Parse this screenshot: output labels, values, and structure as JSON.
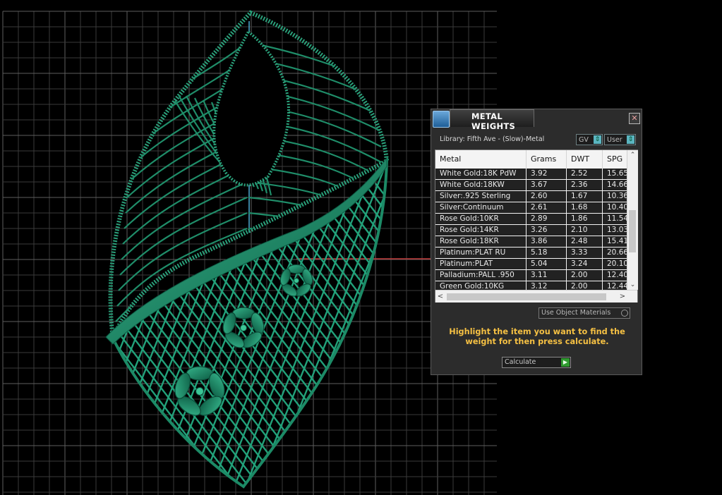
{
  "panel": {
    "title": "METAL WEIGHTS",
    "close_glyph": "✕",
    "library": "Library: Fifth Ave - (Slow)-Metal",
    "gv_label": "GV",
    "user_label": "User",
    "toggle_glyph": "⇕",
    "columns": [
      "Metal",
      "Grams",
      "DWT",
      "SPG"
    ],
    "rows": [
      [
        "White Gold:18K PdW",
        "3.92",
        "2.52",
        "15.65"
      ],
      [
        "White Gold:18KW",
        "3.67",
        "2.36",
        "14.66"
      ],
      [
        "Silver:.925 Sterling",
        "2.60",
        "1.67",
        "10.36"
      ],
      [
        "Silver:Continuum",
        "2.61",
        "1.68",
        "10.40"
      ],
      [
        "Rose Gold:10KR",
        "2.89",
        "1.86",
        "11.54"
      ],
      [
        "Rose Gold:14KR",
        "3.26",
        "2.10",
        "13.03"
      ],
      [
        "Rose Gold:18KR",
        "3.86",
        "2.48",
        "15.41"
      ],
      [
        "Platinum:PLAT RU",
        "5.18",
        "3.33",
        "20.66"
      ],
      [
        "Platinum:PLAT",
        "5.04",
        "3.24",
        "20.10"
      ],
      [
        "Palladium:PALL .950",
        "3.11",
        "2.00",
        "12.40"
      ],
      [
        "Green Gold:10KG",
        "3.12",
        "2.00",
        "12.44"
      ]
    ],
    "scroll_up": "⌃",
    "scroll_down": "⌄",
    "scroll_left": "<",
    "scroll_right": ">",
    "use_object_materials": "Use Object Materials",
    "hint": "Highlight the item you want to find the weight for then press calculate.",
    "calculate_label": "Calculate",
    "calculate_glyph": "▶"
  },
  "colors": {
    "model_green": "#1e8f6a",
    "grid": "#4d4d4d",
    "hint_yellow": "#f5c043"
  },
  "icons": {
    "panel_icon": "rhino-jewel-icon"
  }
}
